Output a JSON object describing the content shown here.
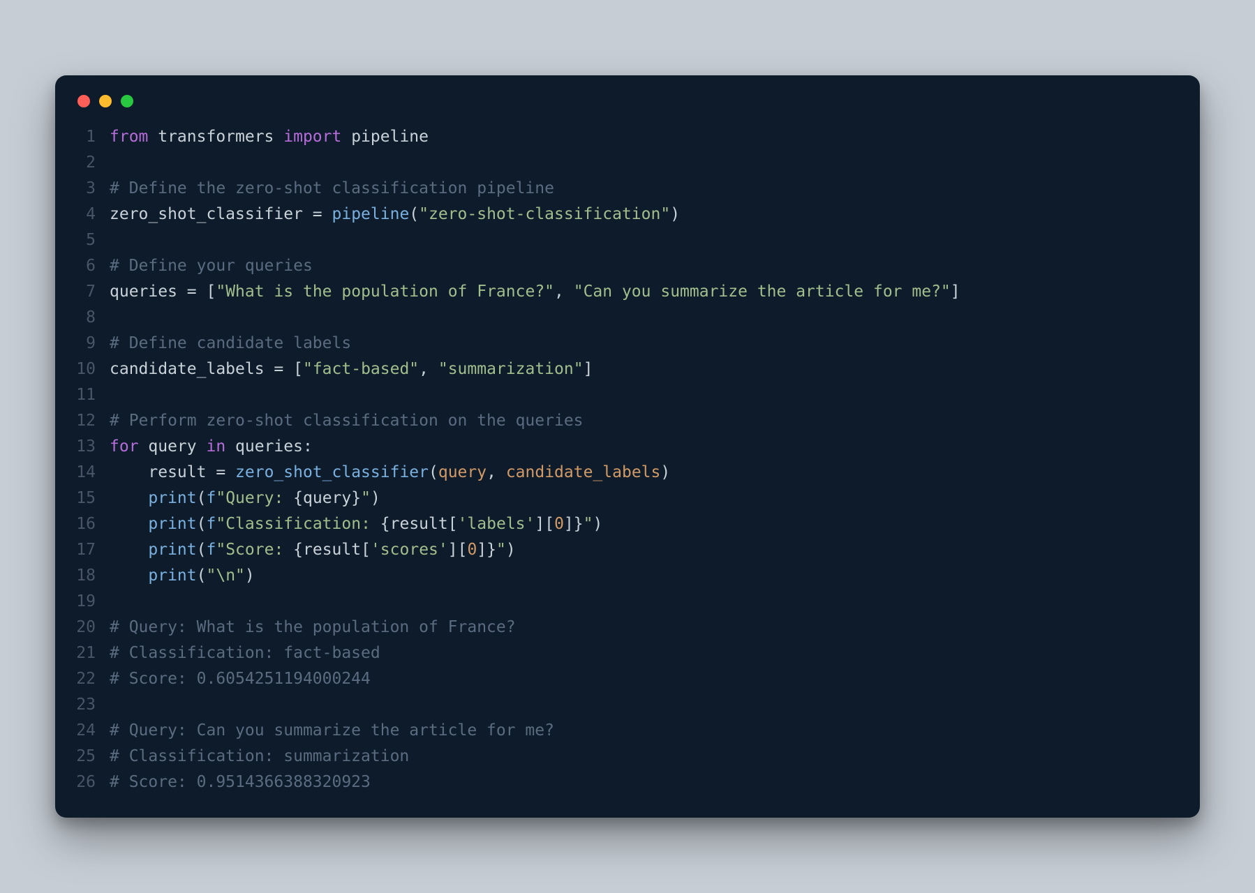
{
  "colors": {
    "background": "#c6cdd5",
    "editor_bg": "#0d1b2a",
    "line_number": "#4a5568",
    "default_text": "#c9d1d9",
    "keyword": "#b66dd9",
    "comment": "#5b6b80",
    "function": "#7ab0df",
    "string": "#a3be8c",
    "param": "#d19a66",
    "traffic_red": "#ff5f57",
    "traffic_yellow": "#febc2e",
    "traffic_green": "#28c840"
  },
  "lines": [
    {
      "n": "1",
      "t": [
        [
          "kw",
          "from"
        ],
        [
          "pl",
          " transformers "
        ],
        [
          "kw",
          "import"
        ],
        [
          "pl",
          " pipeline"
        ]
      ]
    },
    {
      "n": "2",
      "t": []
    },
    {
      "n": "3",
      "t": [
        [
          "cm",
          "# Define the zero-shot classification pipeline"
        ]
      ]
    },
    {
      "n": "4",
      "t": [
        [
          "pl",
          "zero_shot_classifier "
        ],
        [
          "op",
          "="
        ],
        [
          "pl",
          " "
        ],
        [
          "fn",
          "pipeline"
        ],
        [
          "op",
          "("
        ],
        [
          "str",
          "\"zero-shot-classification\""
        ],
        [
          "op",
          ")"
        ]
      ]
    },
    {
      "n": "5",
      "t": []
    },
    {
      "n": "6",
      "t": [
        [
          "cm",
          "# Define your queries"
        ]
      ]
    },
    {
      "n": "7",
      "t": [
        [
          "pl",
          "queries "
        ],
        [
          "op",
          "="
        ],
        [
          "pl",
          " "
        ],
        [
          "op",
          "["
        ],
        [
          "str",
          "\"What is the population of France?\""
        ],
        [
          "op",
          ", "
        ],
        [
          "str",
          "\"Can you summarize the article for me?\""
        ],
        [
          "op",
          "]"
        ]
      ]
    },
    {
      "n": "8",
      "t": []
    },
    {
      "n": "9",
      "t": [
        [
          "cm",
          "# Define candidate labels"
        ]
      ]
    },
    {
      "n": "10",
      "t": [
        [
          "pl",
          "candidate_labels "
        ],
        [
          "op",
          "="
        ],
        [
          "pl",
          " "
        ],
        [
          "op",
          "["
        ],
        [
          "str",
          "\"fact-based\""
        ],
        [
          "op",
          ", "
        ],
        [
          "str",
          "\"summarization\""
        ],
        [
          "op",
          "]"
        ]
      ]
    },
    {
      "n": "11",
      "t": []
    },
    {
      "n": "12",
      "t": [
        [
          "cm",
          "# Perform zero-shot classification on the queries"
        ]
      ]
    },
    {
      "n": "13",
      "t": [
        [
          "kw",
          "for"
        ],
        [
          "pl",
          " query "
        ],
        [
          "kw",
          "in"
        ],
        [
          "pl",
          " queries"
        ],
        [
          "op",
          ":"
        ]
      ]
    },
    {
      "n": "14",
      "t": [
        [
          "pl",
          "    result "
        ],
        [
          "op",
          "="
        ],
        [
          "pl",
          " "
        ],
        [
          "fn",
          "zero_shot_classifier"
        ],
        [
          "op",
          "("
        ],
        [
          "prm",
          "query"
        ],
        [
          "op",
          ", "
        ],
        [
          "prm",
          "candidate_labels"
        ],
        [
          "op",
          ")"
        ]
      ]
    },
    {
      "n": "15",
      "t": [
        [
          "pl",
          "    "
        ],
        [
          "fn",
          "print"
        ],
        [
          "op",
          "("
        ],
        [
          "fstr",
          "f"
        ],
        [
          "str",
          "\"Query: "
        ],
        [
          "op",
          "{"
        ],
        [
          "pl",
          "query"
        ],
        [
          "op",
          "}"
        ],
        [
          "str",
          "\""
        ],
        [
          "op",
          ")"
        ]
      ]
    },
    {
      "n": "16",
      "t": [
        [
          "pl",
          "    "
        ],
        [
          "fn",
          "print"
        ],
        [
          "op",
          "("
        ],
        [
          "fstr",
          "f"
        ],
        [
          "str",
          "\"Classification: "
        ],
        [
          "op",
          "{"
        ],
        [
          "pl",
          "result"
        ],
        [
          "op",
          "["
        ],
        [
          "str",
          "'labels'"
        ],
        [
          "op",
          "]["
        ],
        [
          "num",
          "0"
        ],
        [
          "op",
          "]}"
        ],
        [
          "str",
          "\""
        ],
        [
          "op",
          ")"
        ]
      ]
    },
    {
      "n": "17",
      "t": [
        [
          "pl",
          "    "
        ],
        [
          "fn",
          "print"
        ],
        [
          "op",
          "("
        ],
        [
          "fstr",
          "f"
        ],
        [
          "str",
          "\"Score: "
        ],
        [
          "op",
          "{"
        ],
        [
          "pl",
          "result"
        ],
        [
          "op",
          "["
        ],
        [
          "str",
          "'scores'"
        ],
        [
          "op",
          "]["
        ],
        [
          "num",
          "0"
        ],
        [
          "op",
          "]}"
        ],
        [
          "str",
          "\""
        ],
        [
          "op",
          ")"
        ]
      ]
    },
    {
      "n": "18",
      "t": [
        [
          "pl",
          "    "
        ],
        [
          "fn",
          "print"
        ],
        [
          "op",
          "("
        ],
        [
          "str",
          "\"\\n\""
        ],
        [
          "op",
          ")"
        ]
      ]
    },
    {
      "n": "19",
      "t": []
    },
    {
      "n": "20",
      "t": [
        [
          "cm",
          "# Query: What is the population of France?"
        ]
      ]
    },
    {
      "n": "21",
      "t": [
        [
          "cm",
          "# Classification: fact-based"
        ]
      ]
    },
    {
      "n": "22",
      "t": [
        [
          "cm",
          "# Score: 0.6054251194000244"
        ]
      ]
    },
    {
      "n": "23",
      "t": []
    },
    {
      "n": "24",
      "t": [
        [
          "cm",
          "# Query: Can you summarize the article for me?"
        ]
      ]
    },
    {
      "n": "25",
      "t": [
        [
          "cm",
          "# Classification: summarization"
        ]
      ]
    },
    {
      "n": "26",
      "t": [
        [
          "cm",
          "# Score: 0.9514366388320923"
        ]
      ]
    }
  ]
}
